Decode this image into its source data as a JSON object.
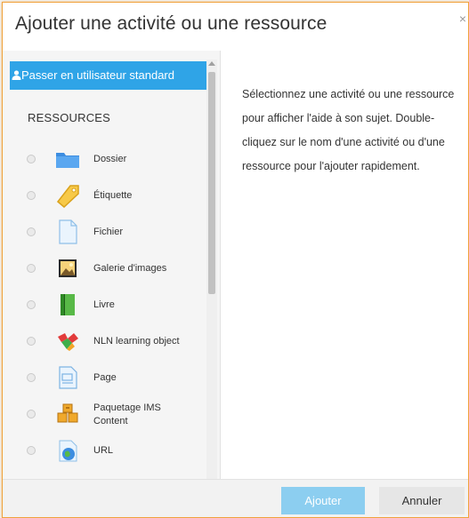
{
  "dialog": {
    "title": "Ajouter une activité ou une ressource",
    "close_glyph": "×"
  },
  "switch_button": {
    "label": "Passer en utilisateur standard",
    "icon": "user-icon"
  },
  "section_title": "RESSOURCES",
  "items": [
    {
      "label": "Dossier",
      "icon": "folder-icon"
    },
    {
      "label": "Étiquette",
      "icon": "tag-icon"
    },
    {
      "label": "Fichier",
      "icon": "file-icon"
    },
    {
      "label": "Galerie d'images",
      "icon": "image-gallery-icon"
    },
    {
      "label": "Livre",
      "icon": "book-icon"
    },
    {
      "label": "NLN learning object",
      "icon": "nln-object-icon"
    },
    {
      "label": "Page",
      "icon": "page-icon"
    },
    {
      "label_line1": "Paquetage IMS",
      "label_line2": "Content",
      "icon": "ims-package-icon"
    },
    {
      "label": "URL",
      "icon": "url-globe-icon"
    }
  ],
  "help_text": "Sélectionnez une activité ou une ressource pour afficher l'aide à son sujet. Double-cliquez sur le nom d'une activité ou d'une ressource pour l'ajouter rapidement.",
  "footer": {
    "add_label": "Ajouter",
    "cancel_label": "Annuler"
  },
  "colors": {
    "accent": "#2fa4e7",
    "add_button_disabled": "#8ccef0",
    "dialog_border": "#f0a23c"
  }
}
